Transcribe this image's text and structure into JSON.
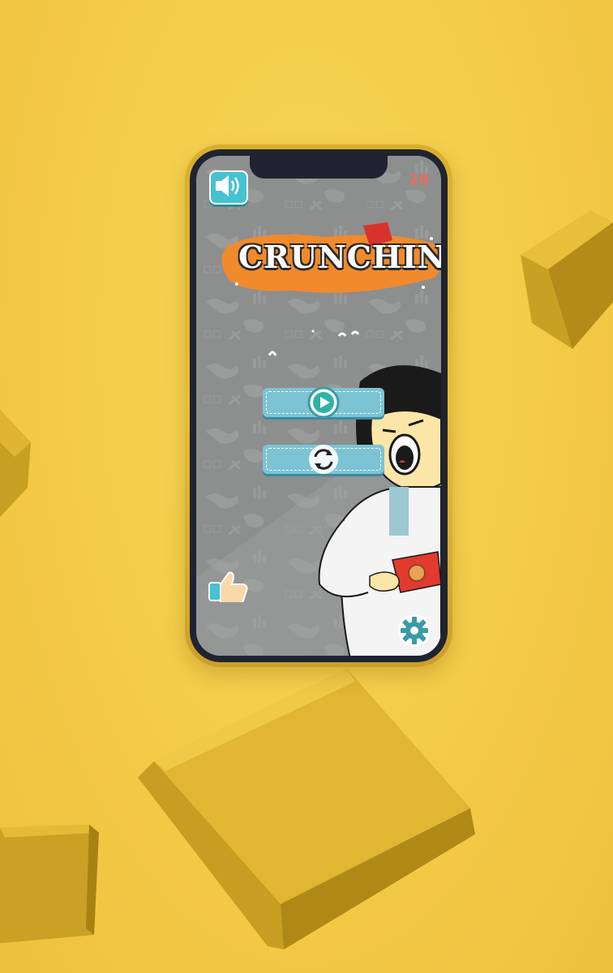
{
  "game": {
    "title": "CRUNCHING",
    "score": "20"
  },
  "colors": {
    "background": "#f3cb47",
    "phone_frame": "#e0b431",
    "button": "#7cc3d6",
    "accent_teal": "#45c3d0",
    "title_orange": "#f08a2c",
    "score_red": "#f06a5a"
  },
  "controls": {
    "sound_icon": "speaker-icon",
    "play_icon": "play-icon",
    "restart_icon": "restart-icon",
    "like_icon": "thumbs-up-icon",
    "settings_icon": "gear-icon"
  }
}
